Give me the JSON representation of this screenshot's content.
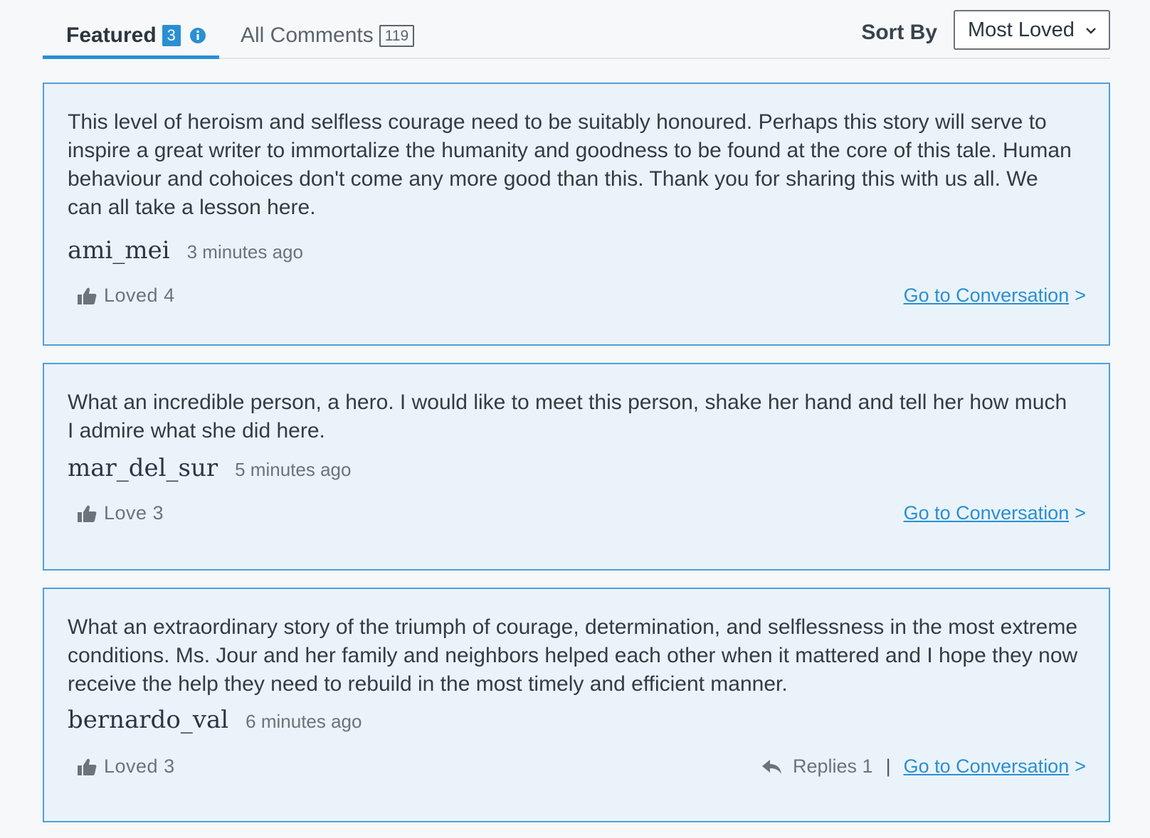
{
  "tabs": [
    {
      "label": "Featured",
      "count": "3"
    },
    {
      "label": "All Comments",
      "count": "119"
    }
  ],
  "sort": {
    "label": "Sort By",
    "value": "Most Loved"
  },
  "comments": [
    {
      "text": "This level of heroism and selfless courage need to be suitably honoured. Perhaps this story will serve to inspire a great writer to immortalize the humanity and goodness to be found at the core of this tale. Human behaviour and cohoices don't come any more good than this. Thank you for sharing this with us all. We can all take a lesson here.",
      "author": "ami_mei",
      "time": "3 minutes ago",
      "love_label": "Loved 4",
      "goto_label": "Go to Conversation",
      "goto_arrow": ">"
    },
    {
      "text": "What an incredible person, a hero. I would like to meet this person, shake her hand and tell her how much I admire what she did here.",
      "author": "mar_del_sur",
      "time": "5 minutes ago",
      "love_label": "Love 3",
      "goto_label": "Go to Conversation",
      "goto_arrow": ">"
    },
    {
      "text": "What an extraordinary story of the triumph of courage, determination, and selflessness in the most extreme conditions. Ms. Jour and her family and neighbors helped each other when it mattered and I hope they now receive the help they need to rebuild in the most timely and efficient manner.",
      "author": "bernardo_val",
      "time": "6 minutes ago",
      "love_label": "Loved 3",
      "replies_label": "Replies 1",
      "separator": "|",
      "goto_label": "Go to Conversation",
      "goto_arrow": ">"
    }
  ],
  "colors": {
    "accent": "#2a8fd3",
    "card_bg": "#eaf3fa",
    "card_border": "#4ea0dc"
  }
}
